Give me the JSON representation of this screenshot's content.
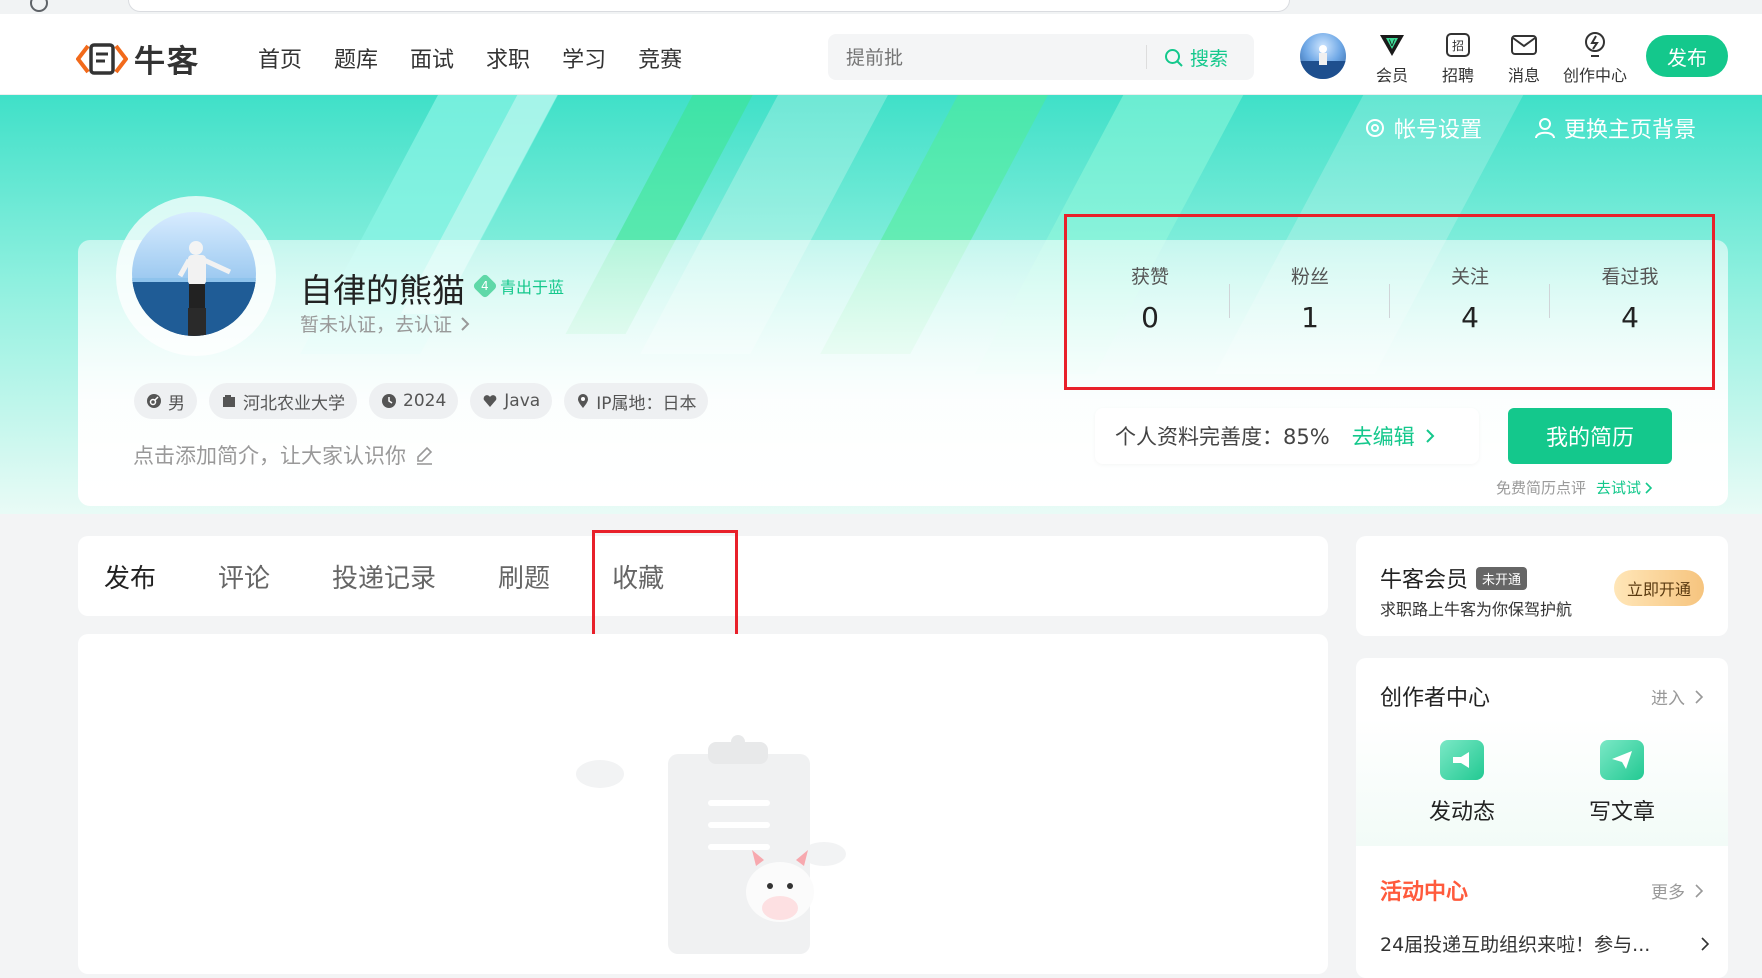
{
  "header": {
    "logo_text": "牛客",
    "nav": [
      "首页",
      "题库",
      "面试",
      "求职",
      "学习",
      "竞赛"
    ],
    "search_placeholder": "提前批",
    "search_button": "搜索",
    "tools": [
      {
        "label": "会员",
        "icon": "vip-icon"
      },
      {
        "label": "招聘",
        "icon": "recruit-icon"
      },
      {
        "label": "消息",
        "icon": "mail-icon"
      },
      {
        "label": "创作中心",
        "icon": "lightbulb-icon"
      }
    ],
    "publish": "发布"
  },
  "banner": {
    "account_settings": "帐号设置",
    "change_background": "更换主页背景"
  },
  "profile": {
    "username": "自律的熊猫",
    "level_mark": "4",
    "level_name": "青出于蓝",
    "verify_text": "暂未认证，去认证",
    "tags": [
      {
        "icon": "gender-icon",
        "text": "男"
      },
      {
        "icon": "school-icon",
        "text": "河北农业大学"
      },
      {
        "icon": "clock-icon",
        "text": "2024"
      },
      {
        "icon": "heart-icon",
        "text": "Java"
      },
      {
        "icon": "location-icon",
        "text": "IP属地：日本"
      }
    ],
    "bio_placeholder": "点击添加简介，让大家认识你"
  },
  "stats": [
    {
      "label": "获赞",
      "value": "0"
    },
    {
      "label": "粉丝",
      "value": "1"
    },
    {
      "label": "关注",
      "value": "4"
    },
    {
      "label": "看过我",
      "value": "4"
    }
  ],
  "completeness": {
    "label": "个人资料完善度：85%",
    "edit": "去编辑"
  },
  "resume": {
    "button": "我的简历",
    "review_text": "免费简历点评",
    "try_text": "去试试"
  },
  "tabs": [
    "发布",
    "评论",
    "投递记录",
    "刷题",
    "收藏"
  ],
  "active_tab": "发布",
  "vip": {
    "title": "牛客会员",
    "badge": "未开通",
    "subtitle": "求职路上牛客为你保驾护航",
    "button": "立即开通"
  },
  "creator": {
    "title": "创作者中心",
    "enter": "进入",
    "actions": [
      "发动态",
      "写文章"
    ]
  },
  "activity": {
    "title": "活动中心",
    "more": "更多",
    "item": "24届投递互助组织来啦！参与..."
  },
  "colors": {
    "brand_green": "#14c88c",
    "highlight_red": "#e8202a",
    "activity_orange": "#ff5a3c"
  }
}
